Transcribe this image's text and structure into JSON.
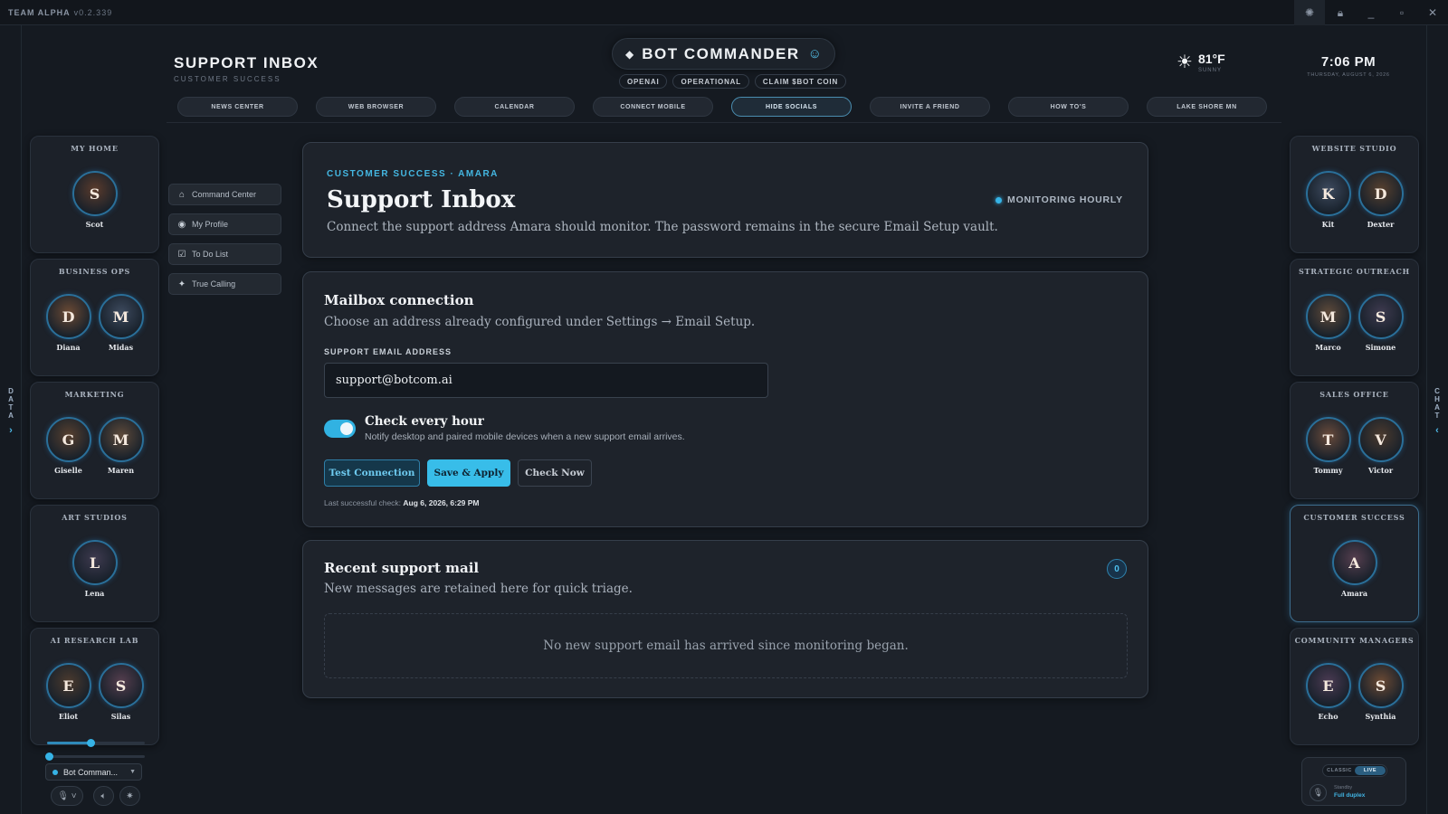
{
  "titlebar": {
    "brand": "TEAM ALPHA",
    "version": "v0.2.339"
  },
  "edges": {
    "left_label": "DATA",
    "right_label": "CHAT"
  },
  "header": {
    "title": "SUPPORT INBOX",
    "subtitle": "CUSTOMER SUCCESS",
    "brand": "BOT COMMANDER",
    "chips": [
      "OPENAI",
      "OPERATIONAL",
      "CLAIM $BOT COIN"
    ],
    "weather": {
      "temp": "81°F",
      "condition": "SUNNY"
    },
    "clock": {
      "time": "7:06 PM",
      "date": "THURSDAY, AUGUST 6, 2026"
    }
  },
  "nav": [
    "NEWS CENTER",
    "WEB BROWSER",
    "CALENDAR",
    "CONNECT MOBILE",
    "HIDE SOCIALS",
    "INVITE A FRIEND",
    "HOW TO'S",
    "LAKE SHORE MN"
  ],
  "nav_active": "HIDE SOCIALS",
  "teams_left": [
    {
      "title": "MY HOME",
      "members": [
        "Scot"
      ]
    },
    {
      "title": "BUSINESS OPS",
      "members": [
        "Diana",
        "Midas"
      ]
    },
    {
      "title": "MARKETING",
      "members": [
        "Giselle",
        "Maren"
      ]
    },
    {
      "title": "ART STUDIOS",
      "members": [
        "Lena"
      ]
    },
    {
      "title": "AI RESEARCH LAB",
      "members": [
        "Eliot",
        "Silas"
      ]
    }
  ],
  "teams_right": [
    {
      "title": "WEBSITE STUDIO",
      "members": [
        "Kit",
        "Dexter"
      ]
    },
    {
      "title": "STRATEGIC OUTREACH",
      "members": [
        "Marco",
        "Simone"
      ]
    },
    {
      "title": "SALES OFFICE",
      "members": [
        "Tommy",
        "Victor"
      ]
    },
    {
      "title": "CUSTOMER SUCCESS",
      "members": [
        "Amara"
      ]
    },
    {
      "title": "COMMUNITY MANAGERS",
      "members": [
        "Echo",
        "Synthia"
      ]
    }
  ],
  "submenu": [
    {
      "icon": "home-icon",
      "label": "Command Center"
    },
    {
      "icon": "profile-icon",
      "label": "My Profile"
    },
    {
      "icon": "checkbox-icon",
      "label": "To Do List"
    },
    {
      "icon": "sparkle-icon",
      "label": "True Calling"
    }
  ],
  "intro": {
    "eyebrow": "CUSTOMER SUCCESS · AMARA",
    "title": "Support Inbox",
    "description": "Connect the support address Amara should monitor. The password remains in the secure Email Setup vault.",
    "status": "MONITORING HOURLY"
  },
  "mailbox": {
    "title": "Mailbox connection",
    "description": "Choose an address already configured under Settings → Email Setup.",
    "field_label": "SUPPORT EMAIL ADDRESS",
    "email": "support@botcom.ai",
    "toggle_on": true,
    "toggle_title": "Check every hour",
    "toggle_desc": "Notify desktop and paired mobile devices when a new support email arrives.",
    "buttons": {
      "test": "Test Connection",
      "save": "Save & Apply",
      "check": "Check Now"
    },
    "last_check_label": "Last successful check:",
    "last_check_value": "Aug 6, 2026, 6:29 PM"
  },
  "recent": {
    "title": "Recent support mail",
    "description": "New messages are retained here for quick triage.",
    "count": "0",
    "empty": "No new support email has arrived since monitoring began."
  },
  "controls": {
    "voice_select": "Bot Comman..."
  },
  "voice_widget": {
    "modes": [
      "CLASSIC",
      "LIVE"
    ],
    "active_mode": "LIVE",
    "state": "Standby",
    "mode_label": "Full duplex"
  },
  "colors": {
    "accent": "#36b3e6",
    "background": "#151a21",
    "panel": "#1e232b"
  }
}
